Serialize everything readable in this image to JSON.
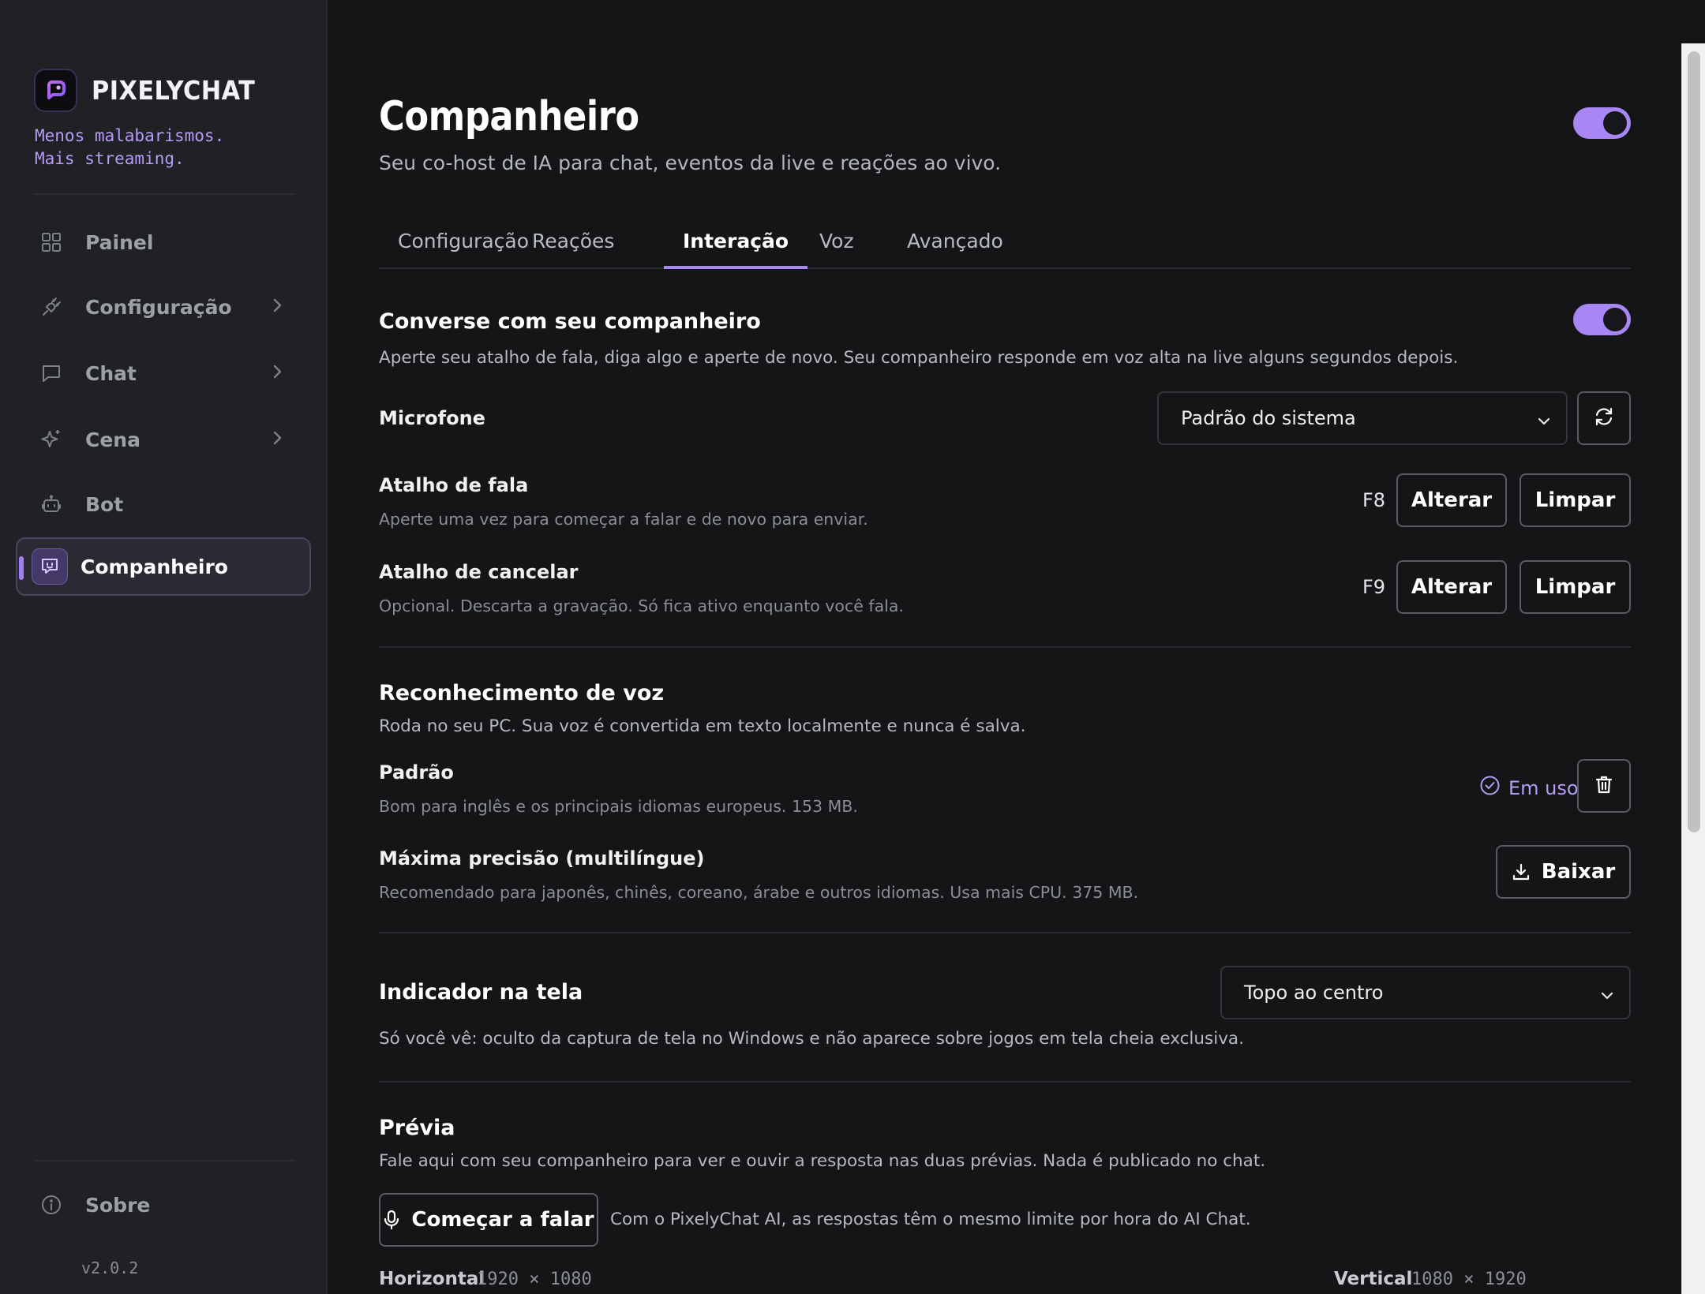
{
  "brand": {
    "name": "PIXELYCHAT",
    "tagline_line1": "Menos malabarismos.",
    "tagline_line2": "Mais streaming."
  },
  "sidebar": {
    "items": [
      {
        "label": "Painel",
        "icon": "grid-icon"
      },
      {
        "label": "Configuração",
        "icon": "plug-icon"
      },
      {
        "label": "Chat",
        "icon": "chat-bubble-icon"
      },
      {
        "label": "Cena",
        "icon": "sparkle-icon"
      },
      {
        "label": "Bot",
        "icon": "robot-icon"
      },
      {
        "label": "Companheiro",
        "icon": "companion-icon",
        "active": true
      }
    ],
    "about_label": "Sobre",
    "version": "v2.0.2"
  },
  "header": {
    "title": "Companheiro",
    "subtitle": "Seu co-host de IA para chat, eventos da live e reações ao vivo.",
    "enabled": true
  },
  "tabs": [
    {
      "label": "Configuração"
    },
    {
      "label": "Reações"
    },
    {
      "label": "Interação",
      "active": true
    },
    {
      "label": "Voz"
    },
    {
      "label": "Avançado"
    }
  ],
  "talk": {
    "title": "Converse com seu companheiro",
    "description": "Aperte seu atalho de fala, diga algo e aperte de novo. Seu companheiro responde em voz alta na live alguns segundos depois.",
    "enabled": true,
    "microphone_label": "Microfone",
    "microphone_value": "Padrão do sistema",
    "talk_hotkey_label": "Atalho de fala",
    "talk_hotkey_desc": "Aperte uma vez para começar a falar e de novo para enviar.",
    "talk_hotkey_key": "F8",
    "cancel_hotkey_label": "Atalho de cancelar",
    "cancel_hotkey_desc": "Opcional. Descarta a gravação. Só fica ativo enquanto você fala.",
    "cancel_hotkey_key": "F9",
    "change_label": "Alterar",
    "clear_label": "Limpar"
  },
  "speech": {
    "title": "Reconhecimento de voz",
    "description": "Roda no seu PC. Sua voz é convertida em texto localmente e nunca é salva.",
    "standard_label": "Padrão",
    "standard_desc": "Bom para inglês e os principais idiomas europeus. 153 MB.",
    "in_use_label": "Em uso",
    "max_label": "Máxima precisão (multilíngue)",
    "max_desc": "Recomendado para japonês, chinês, coreano, árabe e outros idiomas. Usa mais CPU. 375 MB.",
    "download_label": "Baixar"
  },
  "indicator": {
    "title": "Indicador na tela",
    "value": "Topo ao centro",
    "description": "Só você vê: oculto da captura de tela no Windows e não aparece sobre jogos em tela cheia exclusiva."
  },
  "preview": {
    "title": "Prévia",
    "description": "Fale aqui com seu companheiro para ver e ouvir a resposta nas duas prévias. Nada é publicado no chat.",
    "start_label": "Começar a falar",
    "note": "Com o PixelyChat AI, as respostas têm o mesmo limite por hora do AI Chat.",
    "horizontal_label": "Horizontal",
    "horizontal_dims": "1920 × 1080",
    "vertical_label": "Vertical",
    "vertical_dims": "1080 × 1920"
  },
  "colors": {
    "accent": "#a887f4",
    "background": "#141517",
    "sidebar": "#202124"
  }
}
